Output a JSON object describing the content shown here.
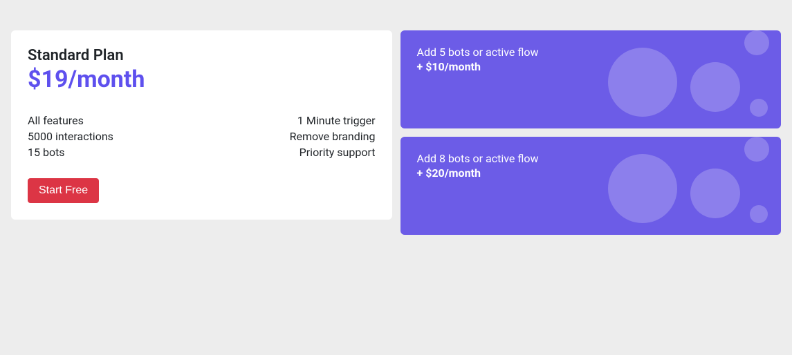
{
  "colors": {
    "accent": "#5e50ee",
    "addonBg": "#6c5ce7",
    "danger": "#dc3545",
    "pageBg": "#ededed"
  },
  "plan": {
    "name": "Standard Plan",
    "price": "$19/month",
    "featuresLeft": [
      "All features",
      "5000 interactions",
      "15 bots"
    ],
    "featuresRight": [
      "1 Minute trigger",
      "Remove branding",
      "Priority support"
    ],
    "cta": "Start Free"
  },
  "addons": [
    {
      "title": "Add 5 bots or active flow",
      "price": "+ $10/month"
    },
    {
      "title": "Add 8 bots or active flow",
      "price": "+ $20/month"
    }
  ]
}
